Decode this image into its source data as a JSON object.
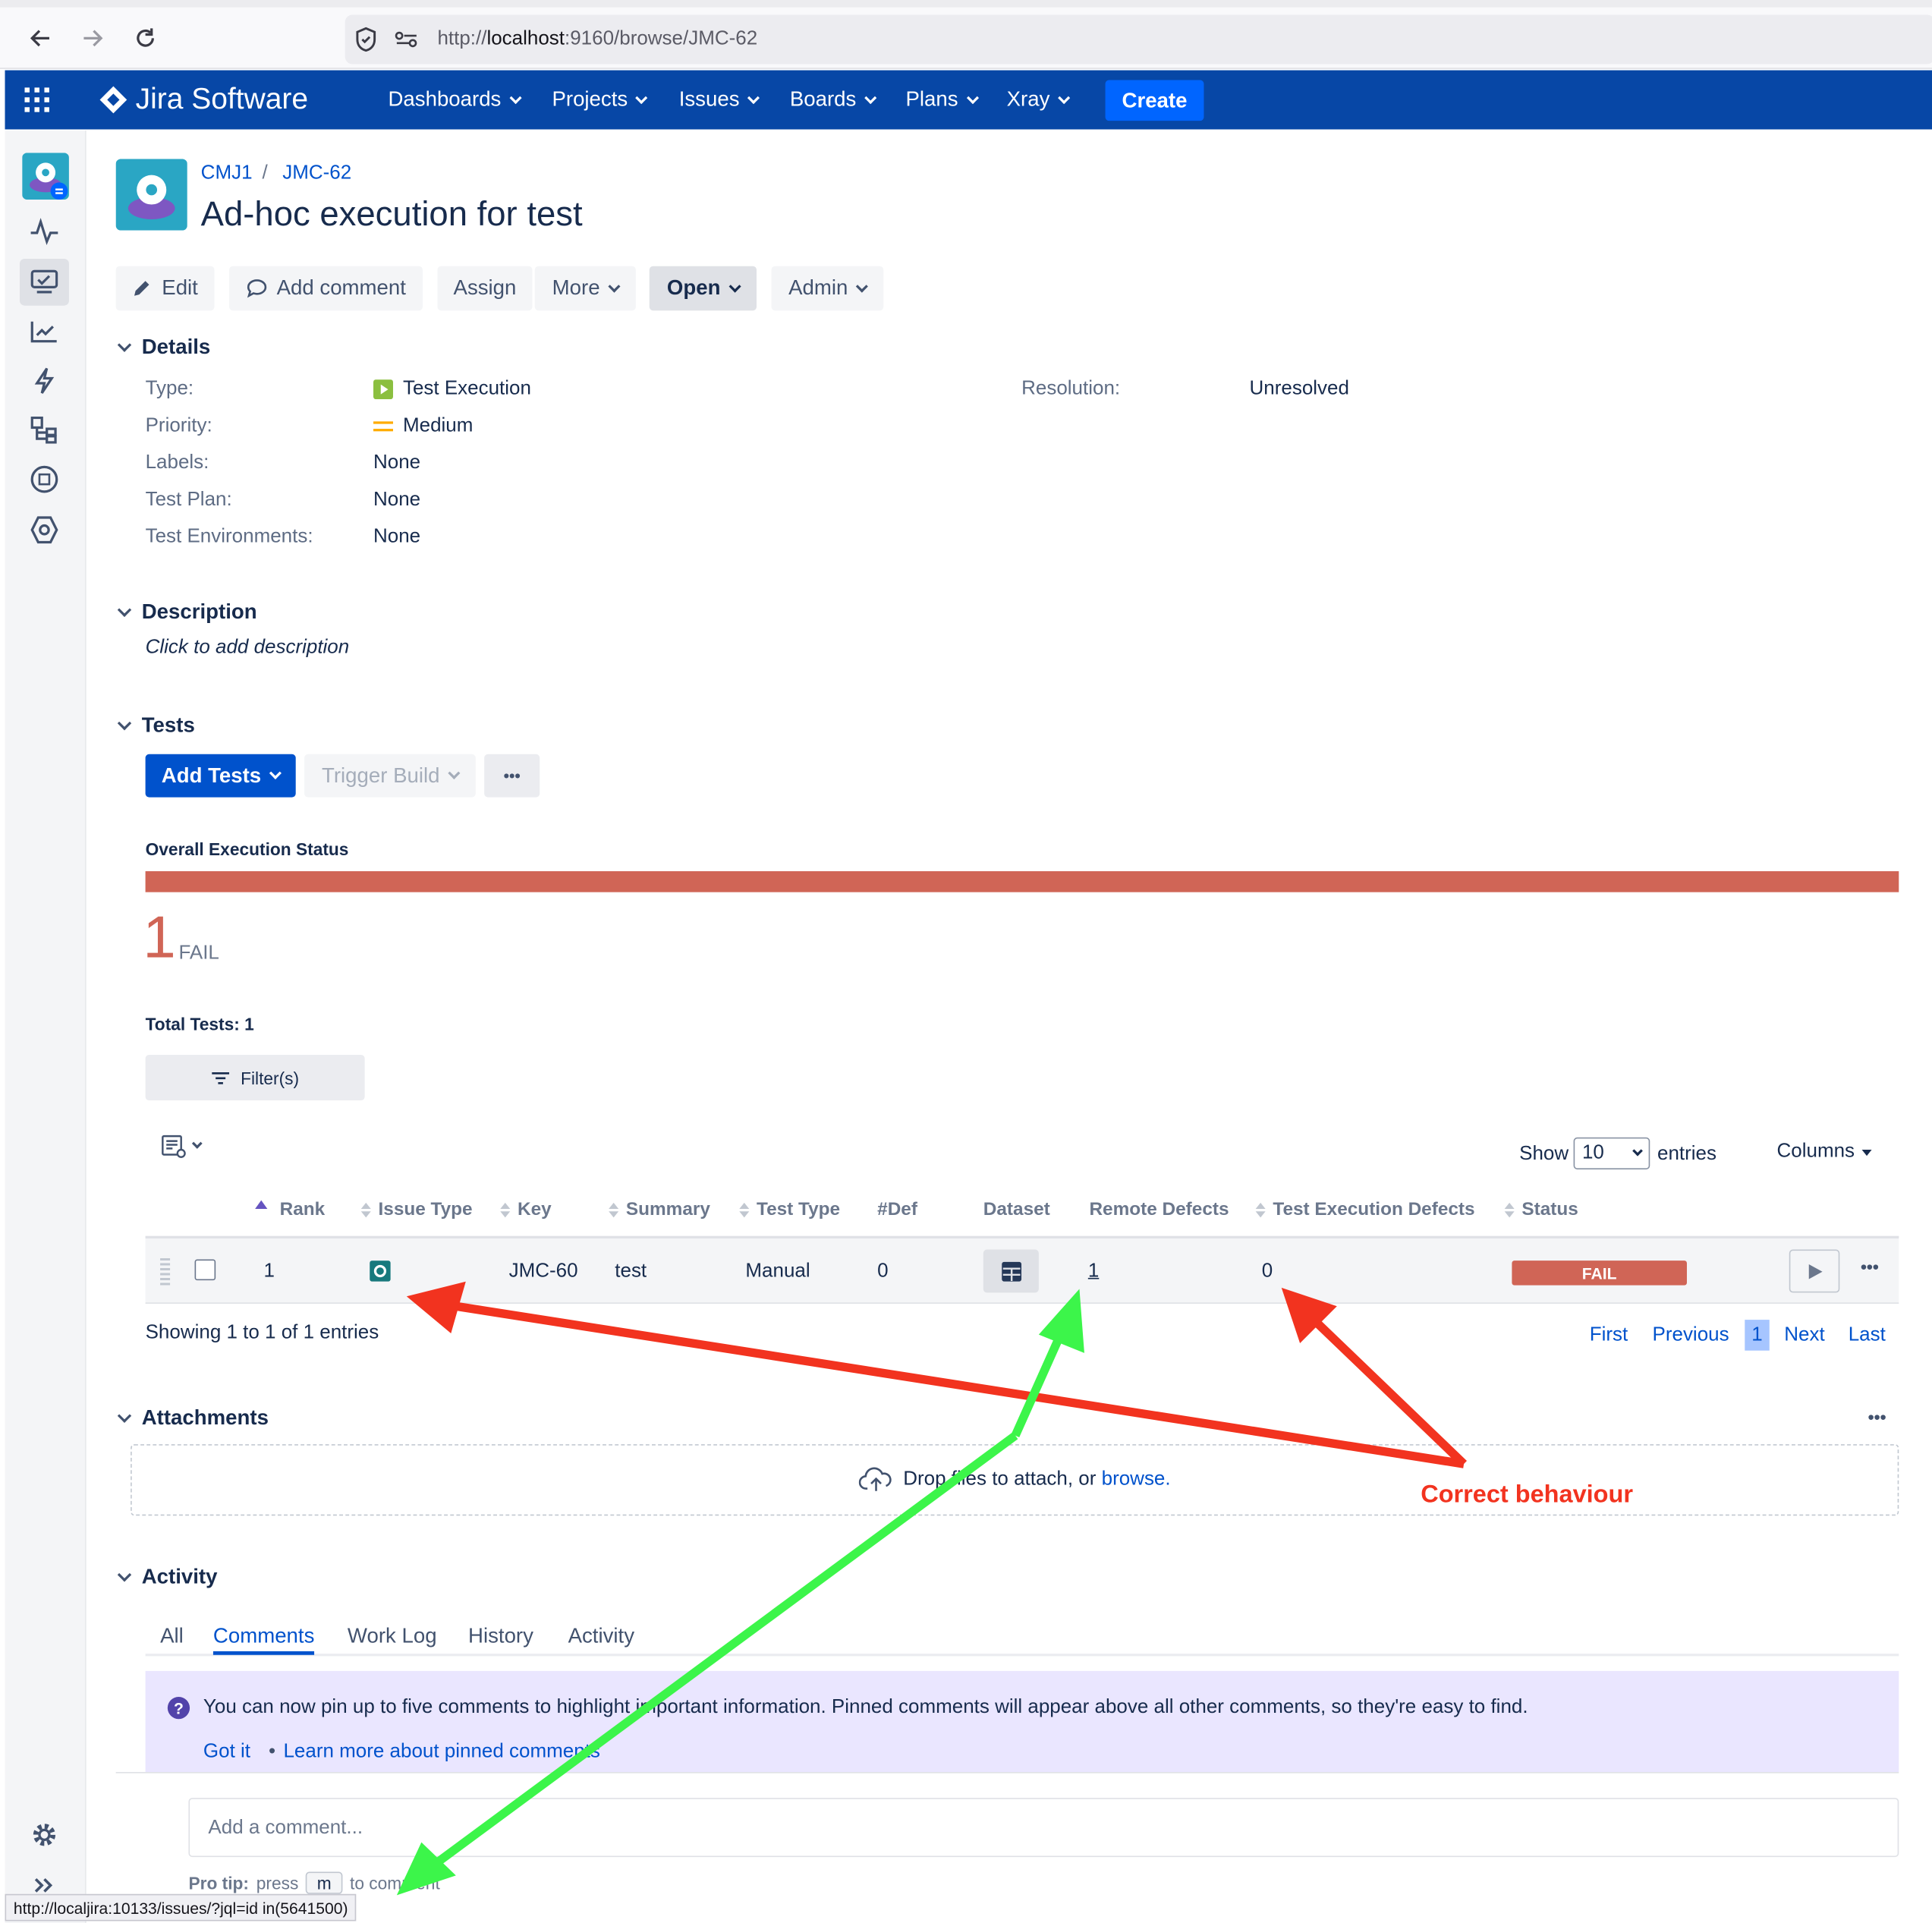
{
  "browser": {
    "url_prefix": "http://",
    "url_host": "localhost",
    "url_rest": ":9160/browse/JMC-62",
    "status_url": "http://localjira:10133/issues/?jql=id in(5641500)"
  },
  "header": {
    "logo_text": "Jira Software",
    "nav": [
      "Dashboards",
      "Projects",
      "Issues",
      "Boards",
      "Plans",
      "Xray"
    ],
    "create_label": "Create"
  },
  "breadcrumb": {
    "project": "CMJ1",
    "separator": "/",
    "issue": "JMC-62"
  },
  "issue": {
    "title": "Ad-hoc execution for test"
  },
  "toolbar": {
    "edit": "Edit",
    "add_comment": "Add comment",
    "assign": "Assign",
    "more": "More",
    "open": "Open",
    "admin": "Admin"
  },
  "details": {
    "heading": "Details",
    "type_label": "Type:",
    "type_value": "Test Execution",
    "priority_label": "Priority:",
    "priority_value": "Medium",
    "labels_label": "Labels:",
    "labels_value": "None",
    "testplan_label": "Test Plan:",
    "testplan_value": "None",
    "testenv_label": "Test Environments:",
    "testenv_value": "None",
    "resolution_label": "Resolution:",
    "resolution_value": "Unresolved"
  },
  "description": {
    "heading": "Description",
    "placeholder": "Click to add description"
  },
  "tests": {
    "heading": "Tests",
    "add_tests": "Add Tests",
    "trigger_build": "Trigger Build",
    "more_dots": "•••",
    "overall_label": "Overall Execution Status",
    "fail_count": "1",
    "fail_label": "FAIL",
    "fail_fraction": 1.0,
    "fail_color": "#d06556",
    "total_tests": "Total Tests: 1",
    "filters": "Filter(s)",
    "show_label": "Show",
    "show_value": "10",
    "entries_label": "entries",
    "columns_label": "Columns",
    "columns": [
      "Rank",
      "Issue Type",
      "Key",
      "Summary",
      "Test Type",
      "#Def",
      "Dataset",
      "Remote Defects",
      "Test Execution Defects",
      "Status"
    ],
    "row": {
      "rank": "1",
      "key": "JMC-60",
      "summary": "test",
      "test_type": "Manual",
      "def": "0",
      "remote_defects": "1",
      "exec_defects": "0",
      "status": "FAIL"
    },
    "showing": "Showing 1 to 1 of 1 entries",
    "pager": {
      "first": "First",
      "previous": "Previous",
      "page": "1",
      "next": "Next",
      "last": "Last"
    }
  },
  "attachments": {
    "heading": "Attachments",
    "drop_text": "Drop files to attach, or ",
    "browse": "browse."
  },
  "activity": {
    "heading": "Activity",
    "tabs": [
      "All",
      "Comments",
      "Work Log",
      "History",
      "Activity"
    ],
    "info_text": "You can now pin up to five comments to highlight important information. Pinned comments will appear above all other comments, so they're easy to find.",
    "got_it": "Got it",
    "bullet": "•",
    "learn_more": "Learn more about pinned comments",
    "comment_placeholder": "Add a comment...",
    "protip_label": "Pro tip:",
    "protip_press": "press",
    "protip_key": "m",
    "protip_rest": "to comment"
  },
  "annotation": {
    "text": "Correct behaviour",
    "red": "#f2331f",
    "green": "#3cf54a"
  }
}
